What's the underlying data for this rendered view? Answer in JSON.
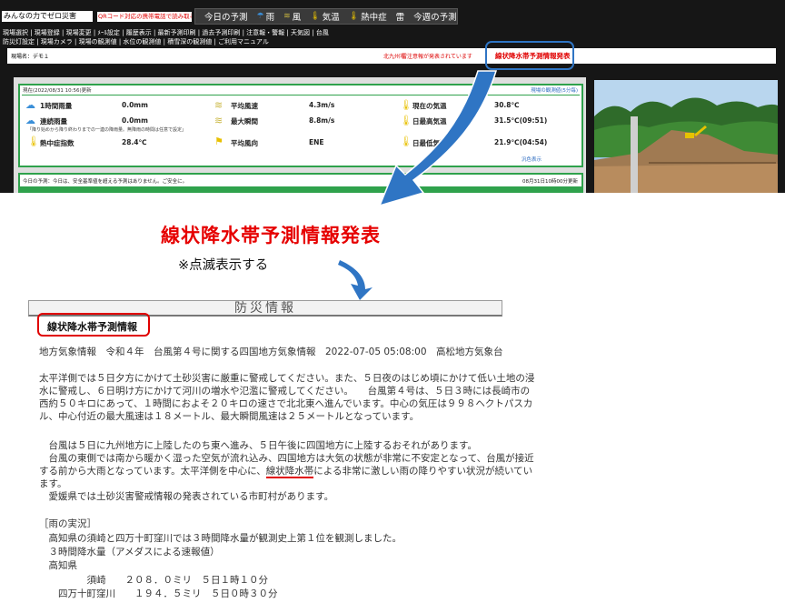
{
  "app": {
    "logo_text": "みんなの力でゼロ災害",
    "qr_note": "QRコード対応の携帯電話で読み取る...",
    "nav": [
      {
        "label": "今日の予測",
        "icon": ""
      },
      {
        "label": "雨",
        "icon": "umbrella-icon"
      },
      {
        "label": "風",
        "icon": "wind-icon"
      },
      {
        "label": "気温",
        "icon": "thermometer-icon"
      },
      {
        "label": "熱中症",
        "icon": "heatstroke-icon"
      },
      {
        "label": "雷",
        "icon": ""
      },
      {
        "label": "今週の予測",
        "icon": ""
      }
    ],
    "menu_row1": "現場選択 | 現場登録 | 現場変更 | ﾒｰﾙ設定 | 履歴表示 | 最新予測印刷 | 過去予測印刷 | 注意報・警報 | 天気図 | 台風",
    "menu_row2": "防災灯設定 | 現場カメラ | 現場の観測値 | 水位の観測値 | 積雪深の観測値 | ご利用マニュアル",
    "location": {
      "name": "現場名：デモ１",
      "city": "北九州市",
      "warning": "雷注意報が発表されています",
      "flash_notice": "線状降水帯予測情報発表"
    },
    "observation": {
      "header": "現在(2022/08/31 10:56)更新",
      "link": "現場の観測値(5分毎)",
      "rain_1h_label": "1時間雨量",
      "rain_1h_value": "0.0mm",
      "rain_cont_label": "連続雨量",
      "rain_cont_value": "0.0mm",
      "rain_cont_note": "「降り始めから降り終わりまでの一連の降雨量。無降雨の時間は任意で設定」",
      "heat_label": "熱中症指数",
      "heat_value": "28.4℃",
      "wind_avg_label": "平均風速",
      "wind_avg_value": "4.3m/s",
      "wind_max_label": "最大瞬間",
      "wind_max_value": "8.8m/s",
      "wind_dir_label": "平均風向",
      "wind_dir_value": "ENE",
      "temp_now_label": "現在の気温",
      "temp_now_value": "30.8℃",
      "temp_high_label": "日最高気温",
      "temp_high_value": "31.5℃(09:51)",
      "temp_low_label": "日最低気温",
      "temp_low_value": "21.9℃(04:54)",
      "footer_link": "汎色表示"
    },
    "forecast": {
      "text": "今日の予測：今日は、安全基準値を超える予測はありません。ご安全に。",
      "date": "08月31日10時00分更新"
    }
  },
  "annotation": {
    "title": "線状降水帯予測情報発表",
    "note": "※点滅表示する"
  },
  "bosai": {
    "header": "防災情報",
    "section_title": "線状降水帯予測情報",
    "lines": [
      "地方気象情報　令和４年　台風第４号に関する四国地方気象情報　2022-07-05 05:08:00　高松地方気象台",
      "",
      "太平洋側では５日夕方にかけて土砂災害に厳重に警戒してください。また、５日夜のはじめ頃にかけて低い土地の浸",
      "水に警戒し、６日明け方にかけて河川の増水や氾濫に警戒してください。　　台風第４号は、５日３時には長崎市の",
      "西約５０キロにあって、１時間におよそ２０キロの速さで北北東へ進んでいます。中心の気圧は９９８ヘクトパスカ",
      "ル、中心付近の最大風速は１８メートル、最大瞬間風速は２５メートルとなっています。",
      "",
      "　台風は５日に九州地方に上陸したのち東へ進み、５日午後に四国地方に上陸するおそれがあります。",
      "　台風の東側では南から暖かく湿った空気が流れ込み、四国地方は大気の状態が非常に不安定となって、台風が接近",
      "する前から大雨となっています。太平洋側を中心に、線状降水帯による非常に激しい雨の降りやすい状況が続いてい",
      "ます。",
      "　愛媛県では土砂災害警戒情報の発表されている市町村があります。",
      "",
      "［雨の実況］",
      "　高知県の須崎と四万十町窪川では３時間降水量が観測史上第１位を観測しました。",
      "　３時間降水量（アメダスによる速報値）",
      "　高知県",
      "　　　　　須崎　　２０８．０ミリ　５日１時１０分",
      "　　四万十町窪川　　１９４．５ミリ　５日０時３０分"
    ],
    "line9_pre": "する前から大雨となっています。太平洋側を中心に、",
    "line9_mark": "線状降水帯",
    "line9_post": "による非常に激しい雨の降りやすい状況が続いてい"
  }
}
